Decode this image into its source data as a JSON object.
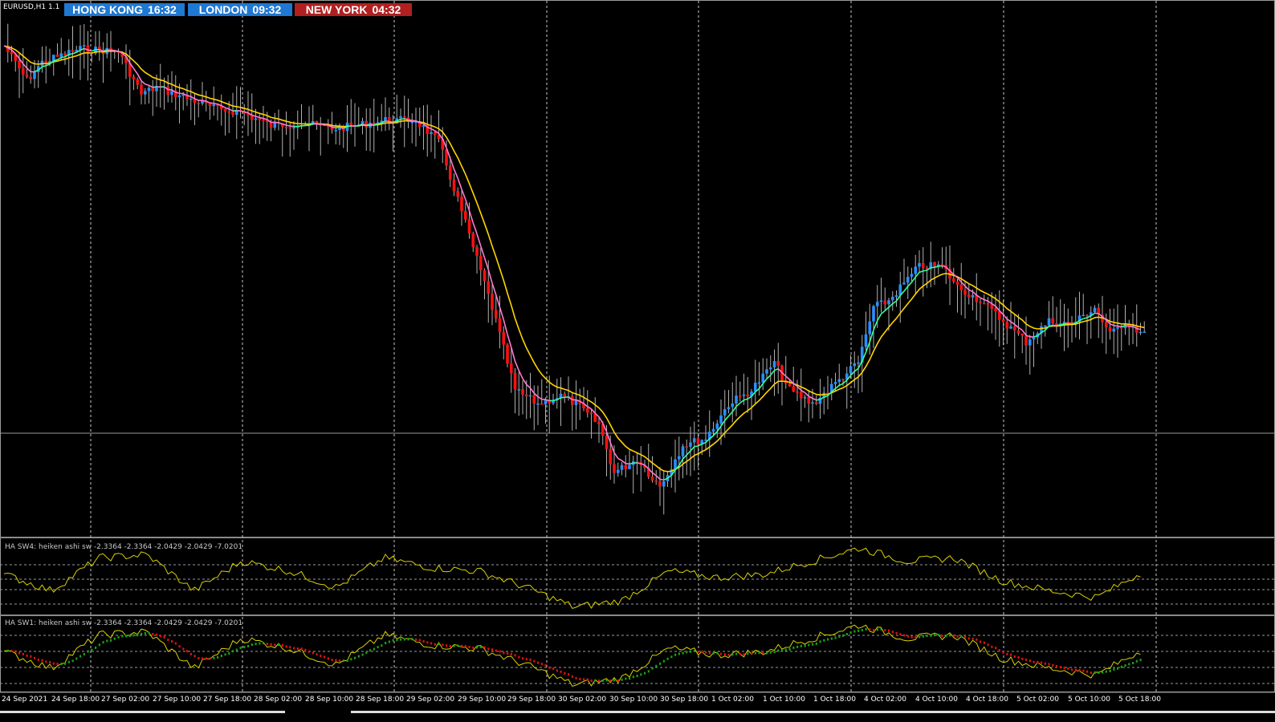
{
  "symbol": "EURUSD,H1",
  "symbol_suffix": "1.1",
  "clocks": [
    {
      "city": "HONG KONG",
      "time": "16:32",
      "color": "#1f78d1"
    },
    {
      "city": "LONDON",
      "time": "09:32",
      "color": "#1f78d1"
    },
    {
      "city": "NEW YORK",
      "time": "04:32",
      "color": "#b02020"
    }
  ],
  "indicators": {
    "sw4_label": "HA SW4: heiken ashi sw -2.3364 -2.3364 -2.0429 -2.0429 -7.0201",
    "sw1_label": "HA SW1: heiken ashi sw -2.3364 -2.3364 -2.0429 -2.0429 -7.0201"
  },
  "colors": {
    "bull_candle": "#2a8fff",
    "bear_candle": "#ff1010",
    "ma_yellow": "#ffd400",
    "ma_pink": "#ff7ad0",
    "ma_green": "#33ff99",
    "osc_line": "#d8d000",
    "dot_up": "#18a018",
    "dot_down": "#e01010"
  },
  "chart_data": {
    "type": "candlestick",
    "x_labels": [
      "24 Sep 2021",
      "24 Sep 18:00",
      "27 Sep 02:00",
      "27 Sep 10:00",
      "27 Sep 18:00",
      "28 Sep 02:00",
      "28 Sep 10:00",
      "28 Sep 18:00",
      "29 Sep 02:00",
      "29 Sep 10:00",
      "29 Sep 18:00",
      "30 Sep 02:00",
      "30 Sep 10:00",
      "30 Sep 18:00",
      "1 Oct 02:00",
      "1 Oct 10:00",
      "1 Oct 18:00",
      "4 Oct 02:00",
      "4 Oct 10:00",
      "4 Oct 18:00",
      "5 Oct 02:00",
      "5 Oct 10:00",
      "5 Oct 18:00"
    ],
    "price_key": [
      {
        "i": 0,
        "p": 0.1
      },
      {
        "i": 6,
        "p": 0.35
      },
      {
        "i": 10,
        "p": 0.22
      },
      {
        "i": 20,
        "p": 0.12
      },
      {
        "i": 30,
        "p": 0.14
      },
      {
        "i": 36,
        "p": 0.45
      },
      {
        "i": 40,
        "p": 0.4
      },
      {
        "i": 48,
        "p": 0.48
      },
      {
        "i": 56,
        "p": 0.56
      },
      {
        "i": 62,
        "p": 0.58
      },
      {
        "i": 70,
        "p": 0.68
      },
      {
        "i": 78,
        "p": 0.66
      },
      {
        "i": 86,
        "p": 0.7
      },
      {
        "i": 92,
        "p": 0.68
      },
      {
        "i": 100,
        "p": 0.64
      },
      {
        "i": 108,
        "p": 0.64
      },
      {
        "i": 114,
        "p": 0.8
      },
      {
        "i": 120,
        "p": 1.3
      },
      {
        "i": 128,
        "p": 2.0
      },
      {
        "i": 134,
        "p": 2.6
      },
      {
        "i": 140,
        "p": 2.7
      },
      {
        "i": 146,
        "p": 2.64
      },
      {
        "i": 150,
        "p": 2.7
      },
      {
        "i": 156,
        "p": 2.85
      },
      {
        "i": 160,
        "p": 3.2
      },
      {
        "i": 166,
        "p": 3.1
      },
      {
        "i": 172,
        "p": 3.3
      },
      {
        "i": 178,
        "p": 3.0
      },
      {
        "i": 184,
        "p": 2.95
      },
      {
        "i": 190,
        "p": 2.7
      },
      {
        "i": 196,
        "p": 2.6
      },
      {
        "i": 202,
        "p": 2.4
      },
      {
        "i": 206,
        "p": 2.6
      },
      {
        "i": 212,
        "p": 2.7
      },
      {
        "i": 218,
        "p": 2.55
      },
      {
        "i": 224,
        "p": 2.4
      },
      {
        "i": 228,
        "p": 2.0
      },
      {
        "i": 232,
        "p": 1.95
      },
      {
        "i": 240,
        "p": 1.7
      },
      {
        "i": 246,
        "p": 1.7
      },
      {
        "i": 250,
        "p": 1.85
      },
      {
        "i": 256,
        "p": 1.95
      },
      {
        "i": 262,
        "p": 2.1
      },
      {
        "i": 268,
        "p": 2.25
      },
      {
        "i": 274,
        "p": 2.1
      },
      {
        "i": 280,
        "p": 2.12
      },
      {
        "i": 286,
        "p": 2.0
      },
      {
        "i": 290,
        "p": 2.2
      },
      {
        "i": 294,
        "p": 2.1
      },
      {
        "i": 299,
        "p": 2.2
      }
    ],
    "oscillator_key": [
      0.55,
      0.3,
      0.8,
      0.85,
      0.3,
      0.75,
      0.6,
      0.35,
      0.8,
      0.65,
      0.6,
      0.35,
      0.05,
      0.15,
      0.6,
      0.5,
      0.55,
      0.75,
      0.95,
      0.75,
      0.8,
      0.45,
      0.3,
      0.2,
      0.6
    ]
  }
}
